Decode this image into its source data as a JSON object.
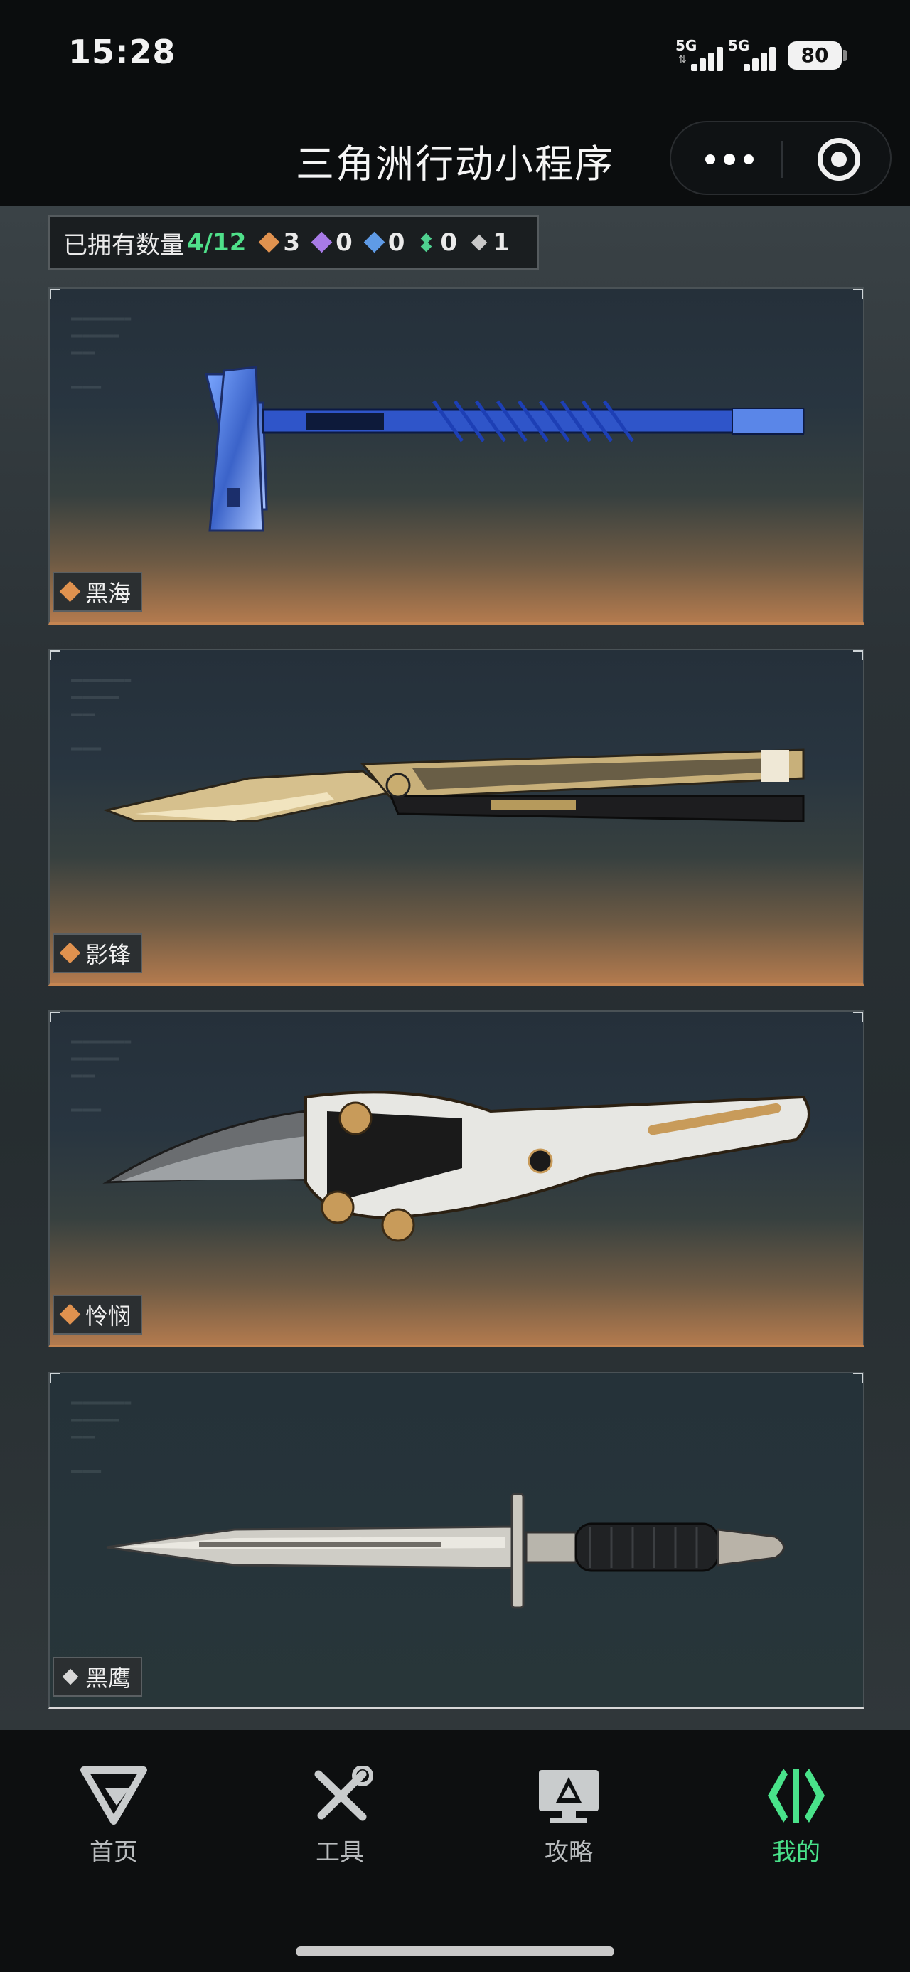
{
  "status_bar": {
    "time": "15:28",
    "network_1": "5G",
    "network_2": "5G",
    "battery": "80"
  },
  "title_bar": {
    "title": "三角洲行动小程序",
    "more_icon": "more-dots-icon",
    "close_icon": "target-circle-icon"
  },
  "summary": {
    "owned_label": "已拥有数量",
    "owned_count": "4/12",
    "rarities": [
      {
        "icon": "orange-gem-icon",
        "color": "#e0924f",
        "count": "3"
      },
      {
        "icon": "purple-gem-icon",
        "color": "#a77ae6",
        "count": "0"
      },
      {
        "icon": "blue-gem-icon",
        "color": "#5f9be6",
        "count": "0"
      },
      {
        "icon": "green-gem-icon",
        "color": "#4fd08f",
        "count": "0"
      },
      {
        "icon": "grey-gem-icon",
        "color": "#c8c8c8",
        "count": "1"
      }
    ]
  },
  "items": [
    {
      "name": "黑海",
      "rarity": "orange",
      "weapon_icon": "tomahawk-axe-icon"
    },
    {
      "name": "影锋",
      "rarity": "orange",
      "weapon_icon": "butterfly-knife-icon"
    },
    {
      "name": "怜悯",
      "rarity": "orange",
      "weapon_icon": "karambit-folding-knife-icon"
    },
    {
      "name": "黑鹰",
      "rarity": "grey",
      "weapon_icon": "combat-dagger-icon"
    }
  ],
  "tabs": [
    {
      "label": "首页",
      "icon": "delta-logo-icon",
      "active": false
    },
    {
      "label": "工具",
      "icon": "tools-icon",
      "active": false
    },
    {
      "label": "攻略",
      "icon": "guide-monitor-icon",
      "active": false
    },
    {
      "label": "我的",
      "icon": "profile-bracket-icon",
      "active": true
    }
  ],
  "colors": {
    "accent_green": "#49e28a",
    "rarity_orange": "#e0924f",
    "card_bottom_glow": "#c58551"
  }
}
